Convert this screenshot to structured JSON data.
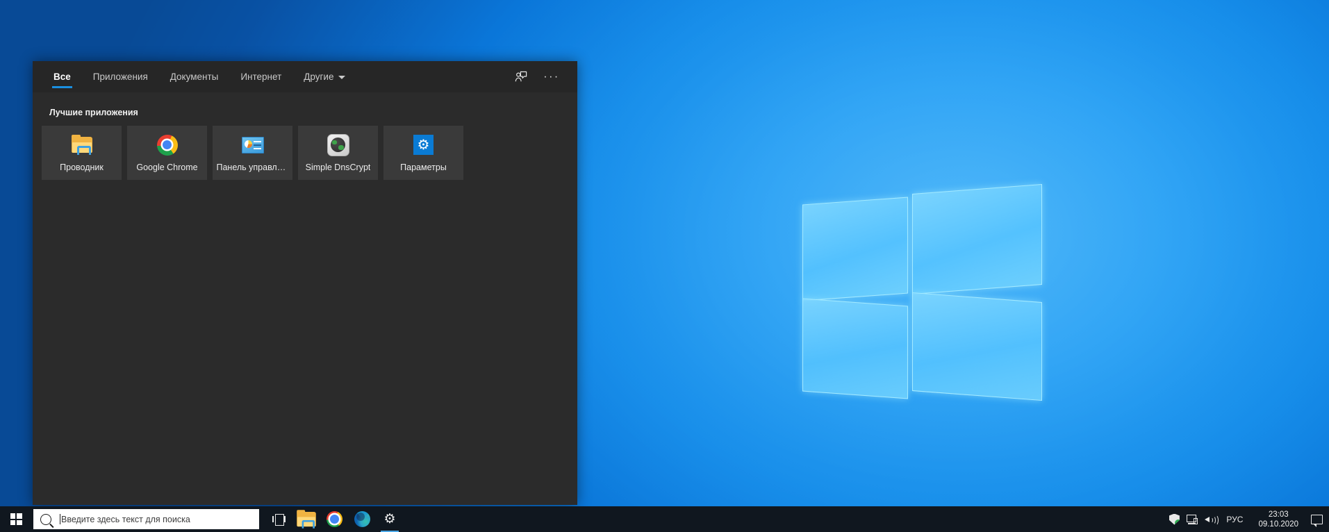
{
  "desktop": {
    "wallpaper_name": "windows-10-hero-wallpaper",
    "accent_color": "#0a7bd4",
    "background_color": "#0b86e8"
  },
  "search_panel": {
    "background_color": "#2b2b2b",
    "header_background_color": "#262626",
    "tabs": [
      {
        "label": "Все",
        "name": "tab-all",
        "active": true
      },
      {
        "label": "Приложения",
        "name": "tab-apps",
        "active": false
      },
      {
        "label": "Документы",
        "name": "tab-documents",
        "active": false
      },
      {
        "label": "Интернет",
        "name": "tab-web",
        "active": false
      },
      {
        "label": "Другие",
        "name": "tab-more",
        "active": false,
        "has_caret": true
      }
    ],
    "header_actions": [
      {
        "name": "feedback-icon",
        "label": ""
      },
      {
        "name": "more-options-icon",
        "label": "···"
      }
    ],
    "section_title": "Лучшие приложения",
    "tiles": [
      {
        "label": "Проводник",
        "icon": "folder-icon"
      },
      {
        "label": "Google Chrome",
        "icon": "chrome-icon"
      },
      {
        "label": "Панель управлен...",
        "icon": "control-panel-icon"
      },
      {
        "label": "Simple DnsCrypt",
        "icon": "dnscrypt-globe-icon"
      },
      {
        "label": "Параметры",
        "icon": "settings-gear-icon"
      }
    ]
  },
  "taskbar": {
    "background_color": "#10171f",
    "start_button": {
      "name": "start-button",
      "icon": "windows-logo-icon"
    },
    "search": {
      "placeholder": "Введите здесь текст для поиска",
      "value": "",
      "icon": "search-magnifier-icon"
    },
    "pinned": [
      {
        "name": "task-view-button",
        "icon": "task-view-icon",
        "active": false
      },
      {
        "name": "file-explorer-button",
        "icon": "folder-icon",
        "active": false
      },
      {
        "name": "chrome-button",
        "icon": "chrome-icon",
        "active": false
      },
      {
        "name": "edge-button",
        "icon": "edge-icon",
        "active": false
      },
      {
        "name": "settings-button",
        "icon": "settings-gear-icon",
        "active": true
      }
    ],
    "tray": {
      "icons": [
        {
          "name": "windows-security-icon",
          "status_color": "#2cab4f"
        },
        {
          "name": "network-icon"
        },
        {
          "name": "volume-icon"
        }
      ],
      "language": "РУС",
      "time": "23:03",
      "date": "09.10.2020",
      "notification_icon": "action-center-icon"
    }
  }
}
